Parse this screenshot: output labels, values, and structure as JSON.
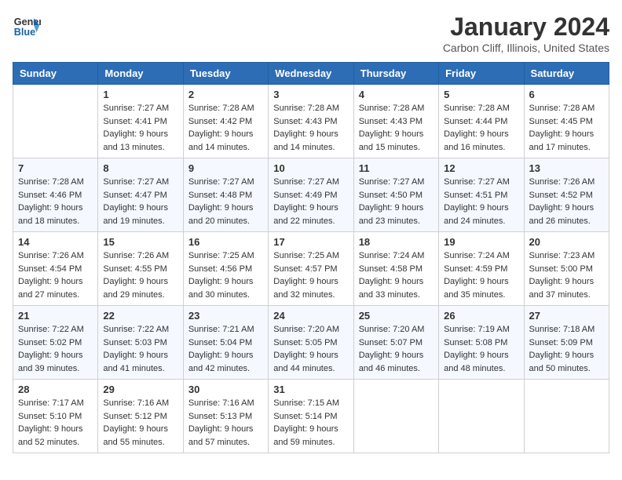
{
  "header": {
    "logo_line1": "General",
    "logo_line2": "Blue",
    "month_title": "January 2024",
    "location": "Carbon Cliff, Illinois, United States"
  },
  "weekdays": [
    "Sunday",
    "Monday",
    "Tuesday",
    "Wednesday",
    "Thursday",
    "Friday",
    "Saturday"
  ],
  "weeks": [
    [
      {
        "day": "",
        "sunrise": "",
        "sunset": "",
        "daylight": ""
      },
      {
        "day": "1",
        "sunrise": "Sunrise: 7:27 AM",
        "sunset": "Sunset: 4:41 PM",
        "daylight": "Daylight: 9 hours and 13 minutes."
      },
      {
        "day": "2",
        "sunrise": "Sunrise: 7:28 AM",
        "sunset": "Sunset: 4:42 PM",
        "daylight": "Daylight: 9 hours and 14 minutes."
      },
      {
        "day": "3",
        "sunrise": "Sunrise: 7:28 AM",
        "sunset": "Sunset: 4:43 PM",
        "daylight": "Daylight: 9 hours and 14 minutes."
      },
      {
        "day": "4",
        "sunrise": "Sunrise: 7:28 AM",
        "sunset": "Sunset: 4:43 PM",
        "daylight": "Daylight: 9 hours and 15 minutes."
      },
      {
        "day": "5",
        "sunrise": "Sunrise: 7:28 AM",
        "sunset": "Sunset: 4:44 PM",
        "daylight": "Daylight: 9 hours and 16 minutes."
      },
      {
        "day": "6",
        "sunrise": "Sunrise: 7:28 AM",
        "sunset": "Sunset: 4:45 PM",
        "daylight": "Daylight: 9 hours and 17 minutes."
      }
    ],
    [
      {
        "day": "7",
        "sunrise": "Sunrise: 7:28 AM",
        "sunset": "Sunset: 4:46 PM",
        "daylight": "Daylight: 9 hours and 18 minutes."
      },
      {
        "day": "8",
        "sunrise": "Sunrise: 7:27 AM",
        "sunset": "Sunset: 4:47 PM",
        "daylight": "Daylight: 9 hours and 19 minutes."
      },
      {
        "day": "9",
        "sunrise": "Sunrise: 7:27 AM",
        "sunset": "Sunset: 4:48 PM",
        "daylight": "Daylight: 9 hours and 20 minutes."
      },
      {
        "day": "10",
        "sunrise": "Sunrise: 7:27 AM",
        "sunset": "Sunset: 4:49 PM",
        "daylight": "Daylight: 9 hours and 22 minutes."
      },
      {
        "day": "11",
        "sunrise": "Sunrise: 7:27 AM",
        "sunset": "Sunset: 4:50 PM",
        "daylight": "Daylight: 9 hours and 23 minutes."
      },
      {
        "day": "12",
        "sunrise": "Sunrise: 7:27 AM",
        "sunset": "Sunset: 4:51 PM",
        "daylight": "Daylight: 9 hours and 24 minutes."
      },
      {
        "day": "13",
        "sunrise": "Sunrise: 7:26 AM",
        "sunset": "Sunset: 4:52 PM",
        "daylight": "Daylight: 9 hours and 26 minutes."
      }
    ],
    [
      {
        "day": "14",
        "sunrise": "Sunrise: 7:26 AM",
        "sunset": "Sunset: 4:54 PM",
        "daylight": "Daylight: 9 hours and 27 minutes."
      },
      {
        "day": "15",
        "sunrise": "Sunrise: 7:26 AM",
        "sunset": "Sunset: 4:55 PM",
        "daylight": "Daylight: 9 hours and 29 minutes."
      },
      {
        "day": "16",
        "sunrise": "Sunrise: 7:25 AM",
        "sunset": "Sunset: 4:56 PM",
        "daylight": "Daylight: 9 hours and 30 minutes."
      },
      {
        "day": "17",
        "sunrise": "Sunrise: 7:25 AM",
        "sunset": "Sunset: 4:57 PM",
        "daylight": "Daylight: 9 hours and 32 minutes."
      },
      {
        "day": "18",
        "sunrise": "Sunrise: 7:24 AM",
        "sunset": "Sunset: 4:58 PM",
        "daylight": "Daylight: 9 hours and 33 minutes."
      },
      {
        "day": "19",
        "sunrise": "Sunrise: 7:24 AM",
        "sunset": "Sunset: 4:59 PM",
        "daylight": "Daylight: 9 hours and 35 minutes."
      },
      {
        "day": "20",
        "sunrise": "Sunrise: 7:23 AM",
        "sunset": "Sunset: 5:00 PM",
        "daylight": "Daylight: 9 hours and 37 minutes."
      }
    ],
    [
      {
        "day": "21",
        "sunrise": "Sunrise: 7:22 AM",
        "sunset": "Sunset: 5:02 PM",
        "daylight": "Daylight: 9 hours and 39 minutes."
      },
      {
        "day": "22",
        "sunrise": "Sunrise: 7:22 AM",
        "sunset": "Sunset: 5:03 PM",
        "daylight": "Daylight: 9 hours and 41 minutes."
      },
      {
        "day": "23",
        "sunrise": "Sunrise: 7:21 AM",
        "sunset": "Sunset: 5:04 PM",
        "daylight": "Daylight: 9 hours and 42 minutes."
      },
      {
        "day": "24",
        "sunrise": "Sunrise: 7:20 AM",
        "sunset": "Sunset: 5:05 PM",
        "daylight": "Daylight: 9 hours and 44 minutes."
      },
      {
        "day": "25",
        "sunrise": "Sunrise: 7:20 AM",
        "sunset": "Sunset: 5:07 PM",
        "daylight": "Daylight: 9 hours and 46 minutes."
      },
      {
        "day": "26",
        "sunrise": "Sunrise: 7:19 AM",
        "sunset": "Sunset: 5:08 PM",
        "daylight": "Daylight: 9 hours and 48 minutes."
      },
      {
        "day": "27",
        "sunrise": "Sunrise: 7:18 AM",
        "sunset": "Sunset: 5:09 PM",
        "daylight": "Daylight: 9 hours and 50 minutes."
      }
    ],
    [
      {
        "day": "28",
        "sunrise": "Sunrise: 7:17 AM",
        "sunset": "Sunset: 5:10 PM",
        "daylight": "Daylight: 9 hours and 52 minutes."
      },
      {
        "day": "29",
        "sunrise": "Sunrise: 7:16 AM",
        "sunset": "Sunset: 5:12 PM",
        "daylight": "Daylight: 9 hours and 55 minutes."
      },
      {
        "day": "30",
        "sunrise": "Sunrise: 7:16 AM",
        "sunset": "Sunset: 5:13 PM",
        "daylight": "Daylight: 9 hours and 57 minutes."
      },
      {
        "day": "31",
        "sunrise": "Sunrise: 7:15 AM",
        "sunset": "Sunset: 5:14 PM",
        "daylight": "Daylight: 9 hours and 59 minutes."
      },
      {
        "day": "",
        "sunrise": "",
        "sunset": "",
        "daylight": ""
      },
      {
        "day": "",
        "sunrise": "",
        "sunset": "",
        "daylight": ""
      },
      {
        "day": "",
        "sunrise": "",
        "sunset": "",
        "daylight": ""
      }
    ]
  ]
}
